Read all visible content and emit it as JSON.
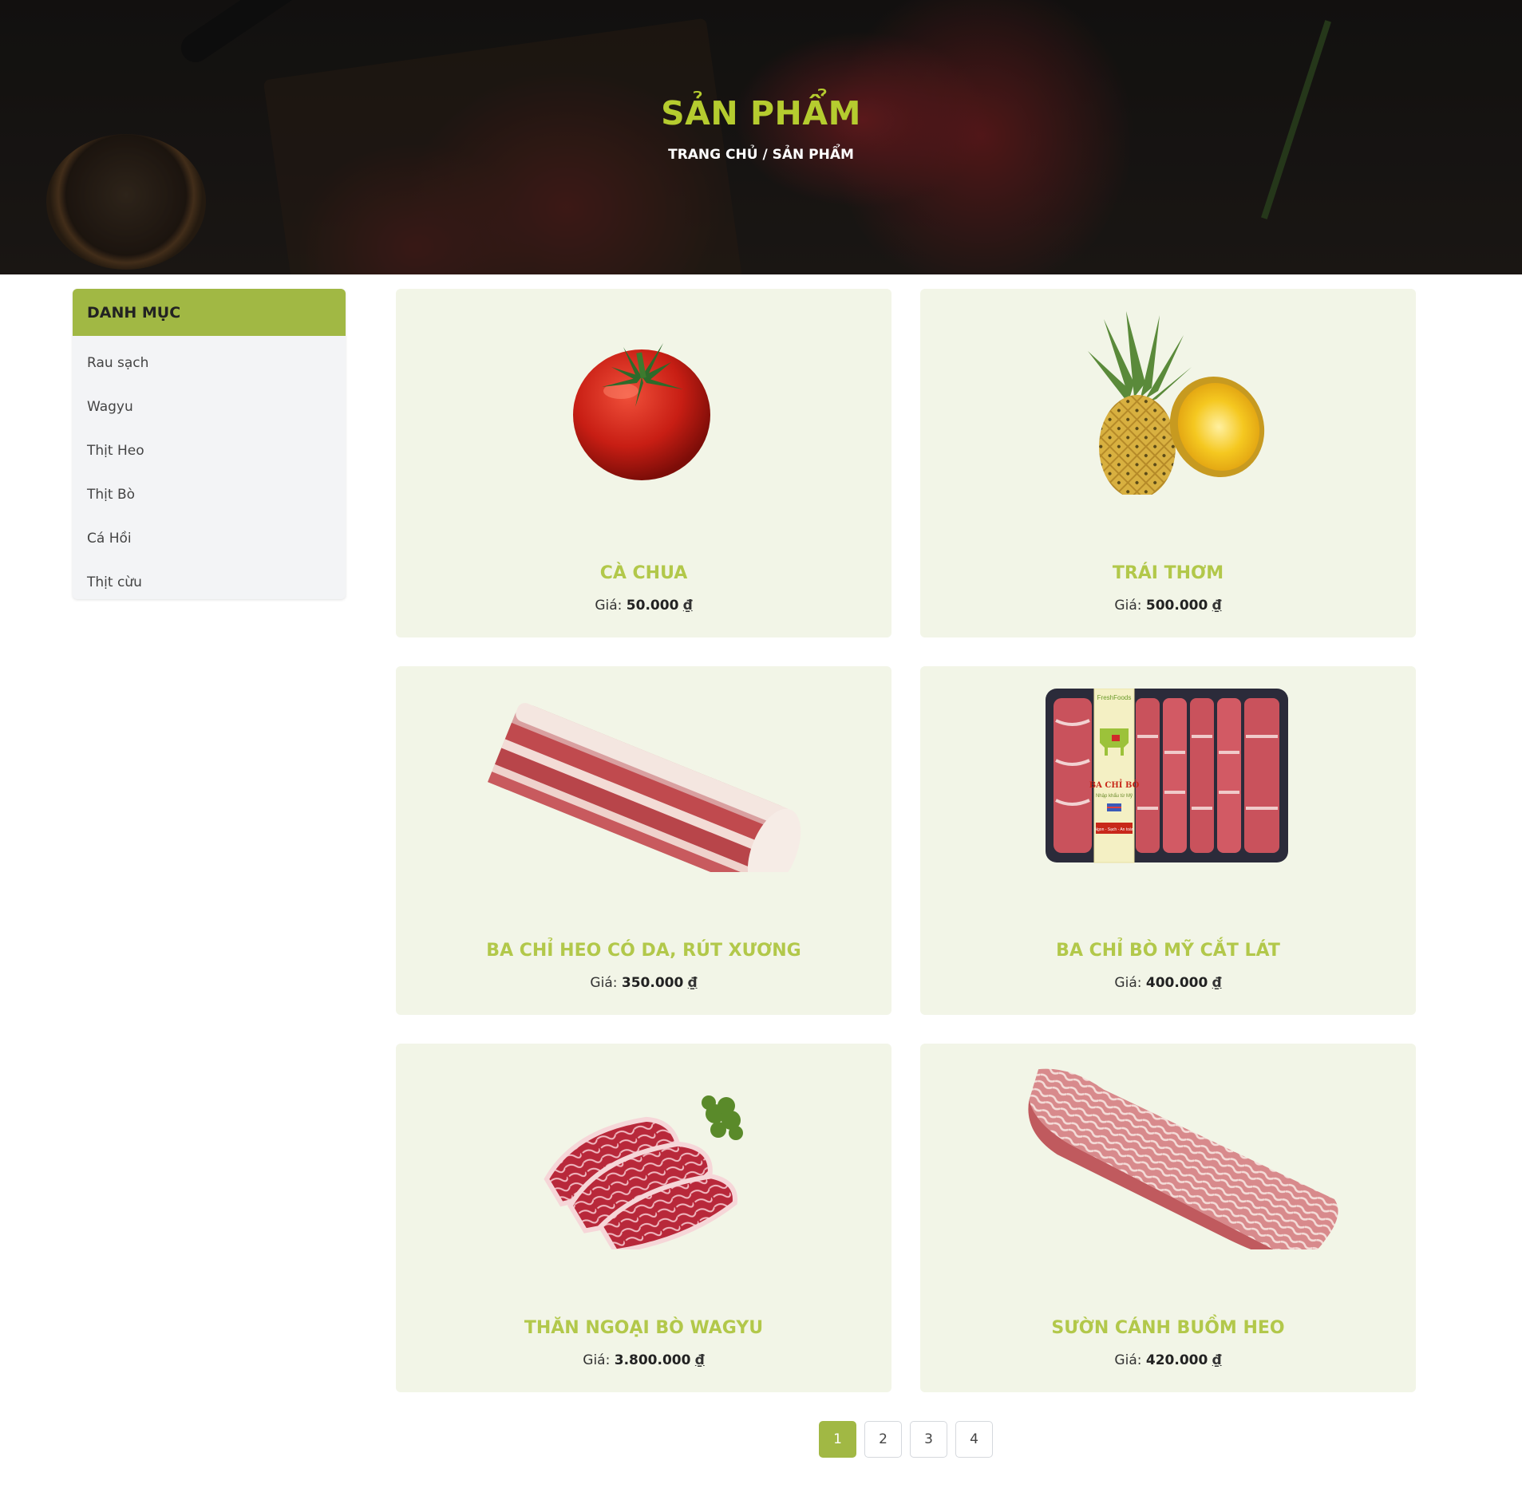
{
  "hero": {
    "title": "SẢN PHẨM",
    "breadcrumb_home": "TRANG CHỦ",
    "breadcrumb_sep": " / ",
    "breadcrumb_current": "SẢN PHẨM"
  },
  "sidebar": {
    "title": "DANH MỤC",
    "items": [
      {
        "label": "Rau sạch"
      },
      {
        "label": "Wagyu"
      },
      {
        "label": "Thịt Heo"
      },
      {
        "label": "Thịt Bò"
      },
      {
        "label": "Cá Hồi"
      },
      {
        "label": "Thịt cừu"
      }
    ]
  },
  "products": [
    {
      "name": "CÀ CHUA",
      "price_label": "Giá:",
      "price": "50.000",
      "currency": "₫",
      "icon": "tomato-image"
    },
    {
      "name": "TRÁI THƠM",
      "price_label": "Giá:",
      "price": "500.000",
      "currency": "₫",
      "icon": "pineapple-image"
    },
    {
      "name": "BA CHỈ HEO CÓ DA, RÚT XƯƠNG",
      "price_label": "Giá:",
      "price": "350.000",
      "currency": "₫",
      "icon": "pork-belly-image"
    },
    {
      "name": "BA CHỈ BÒ MỸ CẮT LÁT",
      "price_label": "Giá:",
      "price": "400.000",
      "currency": "₫",
      "icon": "sliced-beef-tray-image",
      "package": {
        "brand": "FreshFoods",
        "label": "BA CHỈ BÒ",
        "sub": "Nhập khẩu từ Mỹ",
        "tagline": "Ngon - Sạch - An toàn"
      }
    },
    {
      "name": "THĂN NGOẠI BÒ WAGYU",
      "price_label": "Giá:",
      "price": "3.800.000",
      "currency": "₫",
      "icon": "wagyu-steak-image"
    },
    {
      "name": "SƯỜN CÁNH BUỒM HEO",
      "price_label": "Giá:",
      "price": "420.000",
      "currency": "₫",
      "icon": "pork-ribs-image"
    }
  ],
  "pagination": {
    "pages": [
      "1",
      "2",
      "3",
      "4"
    ],
    "current": "1"
  },
  "colors": {
    "accent": "#a1b844",
    "product_name": "#b2c84a",
    "hero_title": "#b5cc2f",
    "card_bg": "#f2f5e7",
    "sidebar_bg": "#f3f4f6"
  }
}
